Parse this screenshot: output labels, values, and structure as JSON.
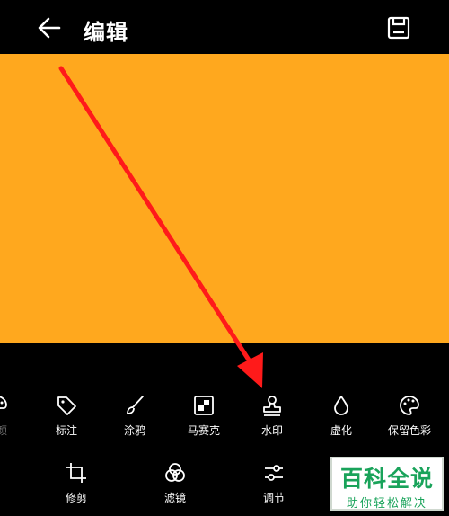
{
  "header": {
    "title": "编辑",
    "back_icon": "arrow-left-icon",
    "save_icon": "save-icon"
  },
  "canvas": {
    "color": "#FFA81E"
  },
  "annotation": {
    "arrow_color": "#FF1A1A"
  },
  "tools_row1": [
    {
      "label": "颜",
      "icon": "palette-icon"
    },
    {
      "label": "标注",
      "icon": "tag-icon"
    },
    {
      "label": "涂鸦",
      "icon": "brush-icon"
    },
    {
      "label": "马赛克",
      "icon": "mosaic-icon"
    },
    {
      "label": "水印",
      "icon": "stamp-icon"
    },
    {
      "label": "虚化",
      "icon": "drop-icon"
    },
    {
      "label": "保留色彩",
      "icon": "palette-icon"
    }
  ],
  "tools_row2": [
    {
      "label": "修剪",
      "icon": "crop-icon"
    },
    {
      "label": "滤镜",
      "icon": "filter-icon"
    },
    {
      "label": "调节",
      "icon": "sliders-icon"
    }
  ],
  "watermark": {
    "main": "百科全说",
    "sub": "助你轻松解决"
  }
}
